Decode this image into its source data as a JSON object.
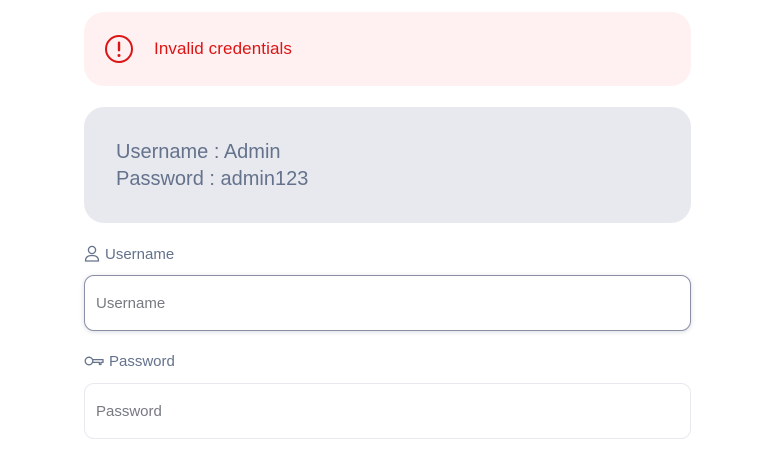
{
  "alert": {
    "message": "Invalid credentials",
    "icon": "alert-circle-icon",
    "color": "#dc1414",
    "background": "#fff1f1"
  },
  "credentials_hint": {
    "username_line": "Username : Admin",
    "password_line": "Password : admin123"
  },
  "form": {
    "username": {
      "label": "Username",
      "icon": "user-icon",
      "placeholder": "Username",
      "value": ""
    },
    "password": {
      "label": "Password",
      "icon": "key-icon",
      "placeholder": "Password",
      "value": ""
    }
  },
  "colors": {
    "label_text": "#64728c",
    "hint_background": "#e8e9ef"
  }
}
